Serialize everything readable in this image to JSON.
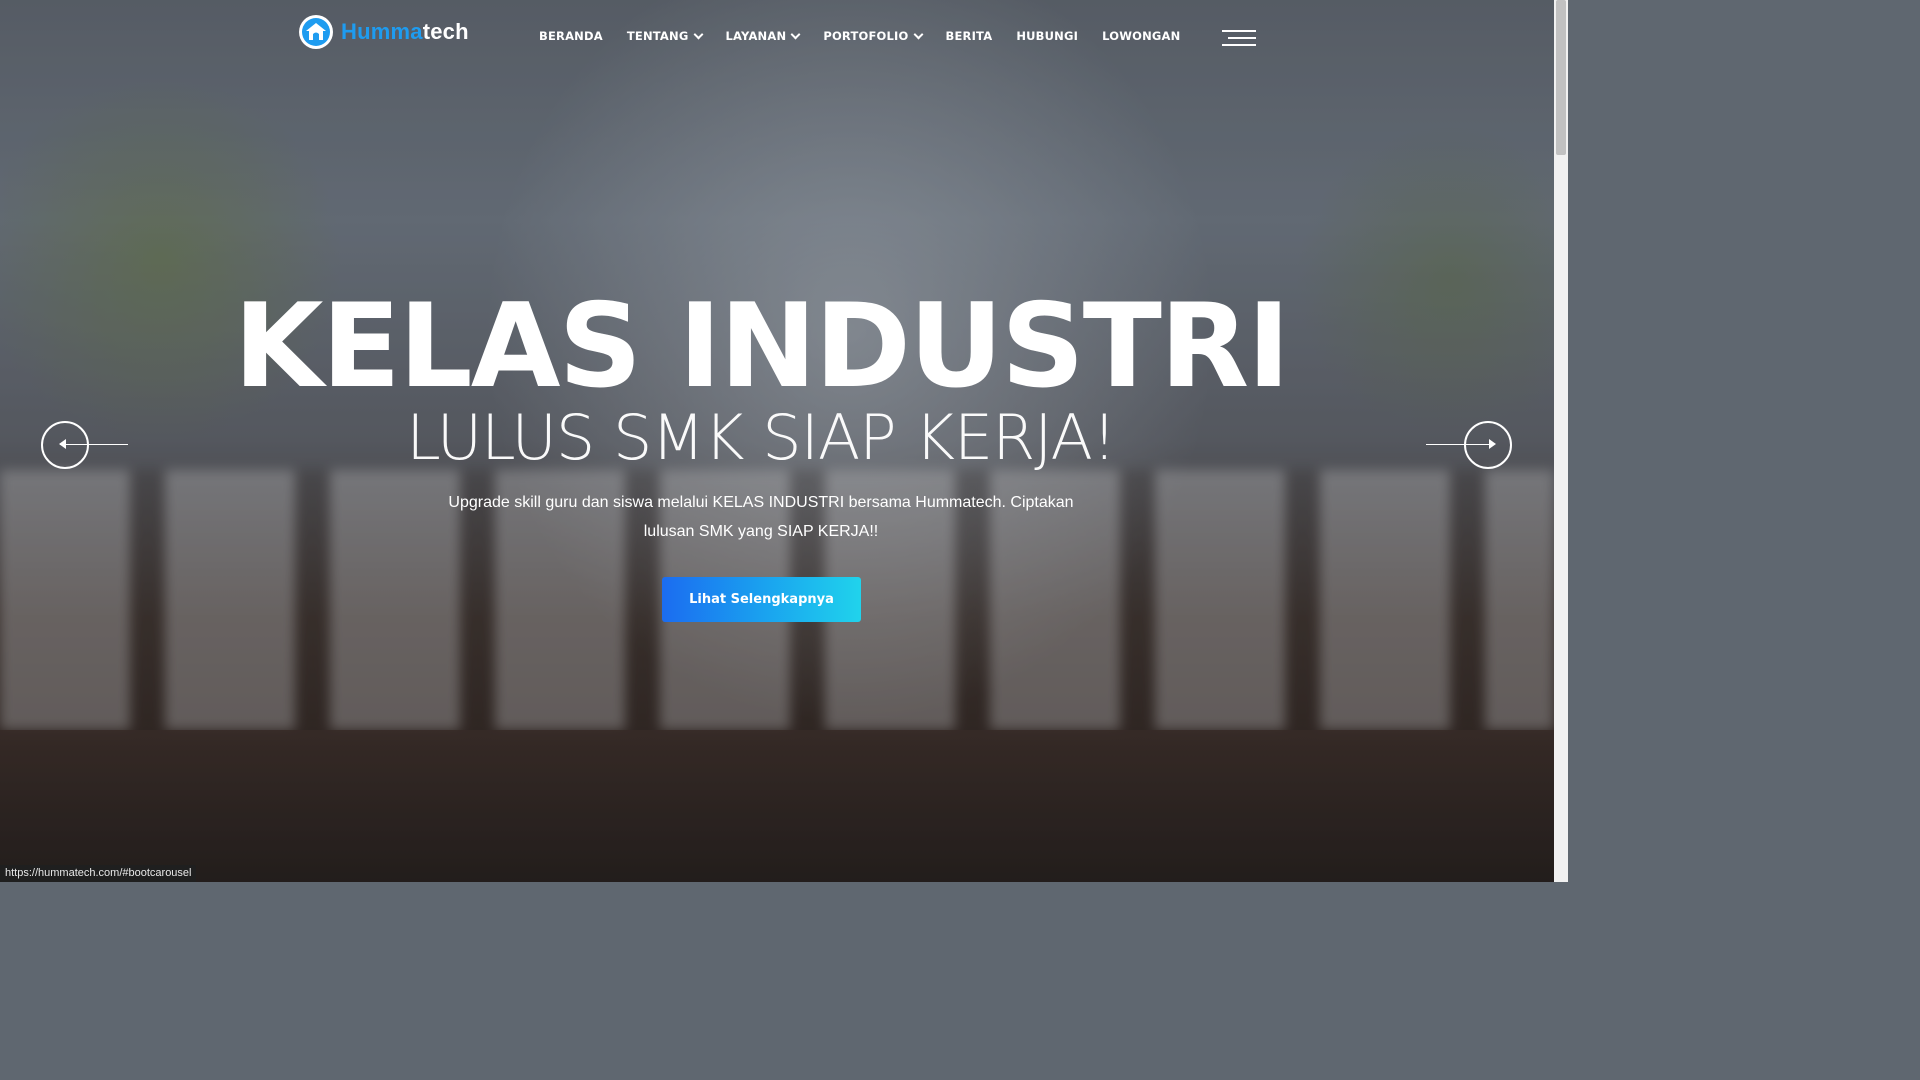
{
  "brand": {
    "name_part1": "Humma",
    "name_part2": "tech",
    "logo_icon": "house-icon",
    "accent_color": "#1e9cf0"
  },
  "nav": {
    "items": [
      {
        "label": "BERANDA",
        "has_dropdown": false
      },
      {
        "label": "TENTANG",
        "has_dropdown": true
      },
      {
        "label": "LAYANAN",
        "has_dropdown": true
      },
      {
        "label": "PORTOFOLIO",
        "has_dropdown": true
      },
      {
        "label": "BERITA",
        "has_dropdown": false
      },
      {
        "label": "HUBUNGI",
        "has_dropdown": false
      },
      {
        "label": "LOWONGAN",
        "has_dropdown": false
      }
    ],
    "menu_icon": "hamburger-menu-icon"
  },
  "hero": {
    "title": "KELAS INDUSTRI",
    "subtitle": "LULUS SMK SIAP KERJA!",
    "description": "Upgrade skill guru dan siswa melalui KELAS INDUSTRI bersama Hummatech. Ciptakan lulusan SMK yang SIAP KERJA!!",
    "cta_label": "Lihat Selengkapnya",
    "cta_gradient": [
      "#1b6cf0",
      "#20d3ec"
    ]
  },
  "carousel": {
    "prev_icon": "arrow-left-icon",
    "next_icon": "arrow-right-icon"
  },
  "status": {
    "url": "https://hummatech.com/#bootcarousel"
  }
}
